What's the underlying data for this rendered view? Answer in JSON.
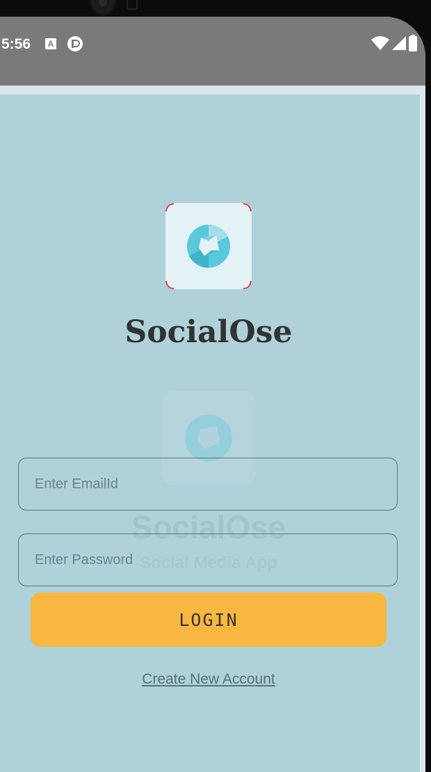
{
  "status_bar": {
    "time": "5:56",
    "notification_icons": [
      "a-box-icon",
      "p-circle-icon"
    ],
    "system_icons": [
      "wifi-icon",
      "cell-signal-icon",
      "battery-icon"
    ]
  },
  "app": {
    "name": "SocialOse",
    "ghost_name": "SocialOse",
    "ghost_tagline": "Social Media App"
  },
  "form": {
    "email_placeholder": "Enter EmailId",
    "email_value": "",
    "password_placeholder": "Enter Password",
    "password_value": "",
    "login_label": "LOGIN",
    "create_account_label": "Create New Account"
  },
  "colors": {
    "background": "#afd1da",
    "status_bar": "#7a7a7a",
    "login_button": "#f7b741",
    "logo_tile": "#e2f2f5",
    "logo_accent": "#5ac8dc"
  }
}
